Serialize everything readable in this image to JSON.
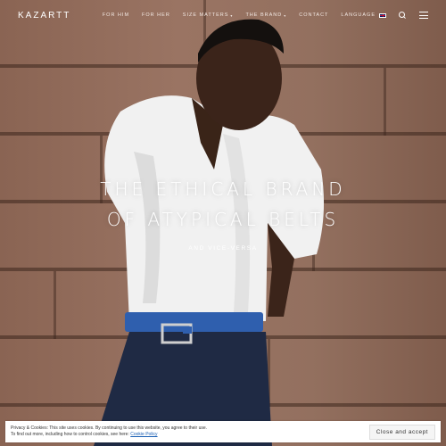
{
  "header": {
    "logo": "KAZARTT",
    "nav": [
      {
        "label": "FOR HIM",
        "dropdown": false
      },
      {
        "label": "FOR HER",
        "dropdown": false
      },
      {
        "label": "SIZE MATTERS",
        "dropdown": true
      },
      {
        "label": "THE BRAND",
        "dropdown": true
      },
      {
        "label": "CONTACT",
        "dropdown": false
      },
      {
        "label": "LANGUAGE",
        "dropdown": false
      }
    ],
    "icons": [
      "uk-flag-icon",
      "search-icon",
      "menu-icon"
    ]
  },
  "hero": {
    "headline_line1": "THE ETHICAL BRAND",
    "headline_line2": "OF ATYPICAL BELTS",
    "subline": "AND VICE-VERSA"
  },
  "cookie": {
    "line1": "Privacy & Cookies: This site uses cookies. By continuing to use this website, you agree to their use.",
    "line2_prefix": "To find out more, including how to control cookies, see here: ",
    "link": "Cookie Policy",
    "button": "Close and accept"
  },
  "colors": {
    "wall": "#93705f",
    "shirt": "#f2f2f2",
    "belt": "#2f5fae",
    "trousers": "#1f2a44",
    "text": "#ffffff"
  }
}
